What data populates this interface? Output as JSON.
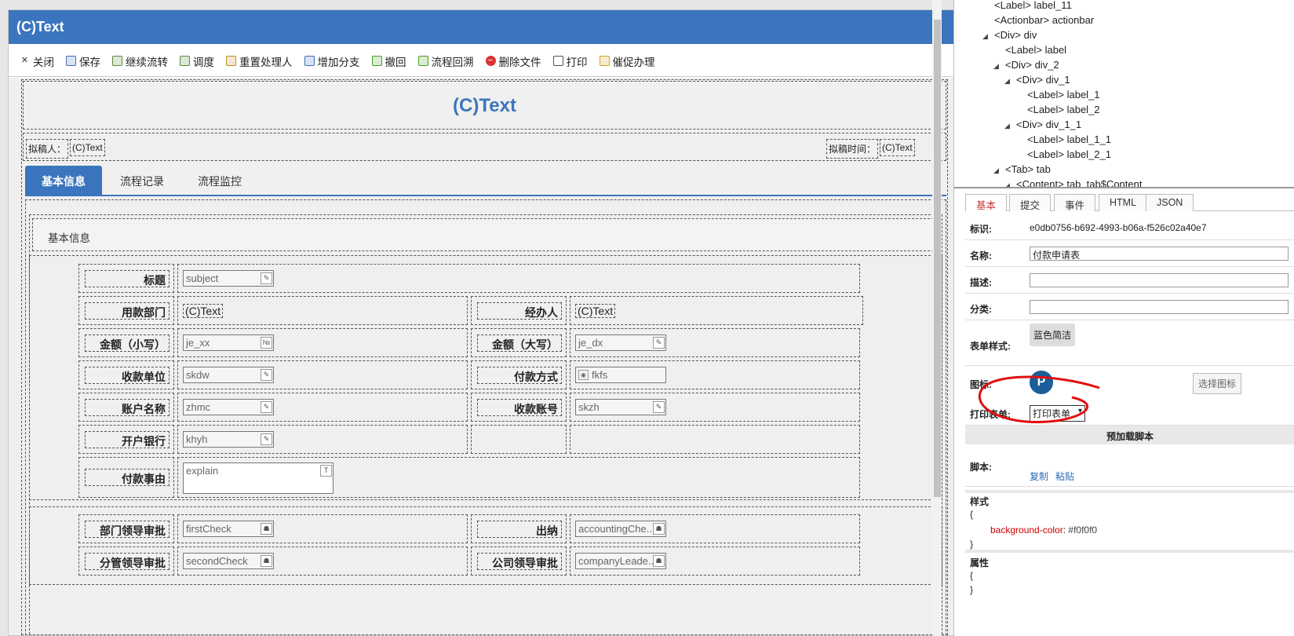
{
  "app_title": "(C)Text",
  "toolbar": [
    {
      "icon": "close-icon",
      "label": "关闭",
      "name": "close"
    },
    {
      "icon": "save-icon",
      "label": "保存",
      "name": "save"
    },
    {
      "icon": "continue-icon",
      "label": "继续流转",
      "name": "continue-flow"
    },
    {
      "icon": "adjust-icon",
      "label": "调度",
      "name": "dispatch"
    },
    {
      "icon": "reset-icon",
      "label": "重置处理人",
      "name": "reset-handler"
    },
    {
      "icon": "branch-icon",
      "label": "增加分支",
      "name": "add-branch"
    },
    {
      "icon": "undo-icon",
      "label": "撤回",
      "name": "withdraw"
    },
    {
      "icon": "trace-icon",
      "label": "流程回溯",
      "name": "flow-trace"
    },
    {
      "icon": "delete-icon",
      "label": "删除文件",
      "name": "delete-file"
    },
    {
      "icon": "print-icon",
      "label": "打印",
      "name": "print"
    },
    {
      "icon": "urge-icon",
      "label": "催促办理",
      "name": "urge"
    }
  ],
  "form": {
    "header_text": "(C)Text",
    "drafter_label": "拟稿人：",
    "drafter_value": "(C)Text",
    "draft_time_label": "拟稿时间：",
    "draft_time_value": "(C)Text",
    "tabs": [
      "基本信息",
      "流程记录",
      "流程监控"
    ],
    "section_title": "基本信息",
    "fields": {
      "subject": {
        "label": "标题",
        "value": "subject"
      },
      "dept": {
        "label": "用款部门",
        "value": "(C)Text"
      },
      "handler": {
        "label": "经办人",
        "value": "(C)Text"
      },
      "amount_small": {
        "label": "金额（小写）",
        "value": "je_xx"
      },
      "amount_big": {
        "label": "金额（大写）",
        "value": "je_dx"
      },
      "payee": {
        "label": "收款单位",
        "value": "skdw"
      },
      "pay_method": {
        "label": "付款方式",
        "value": "fkfs"
      },
      "account_name": {
        "label": "账户名称",
        "value": "zhmc"
      },
      "account_no": {
        "label": "收款账号",
        "value": "skzh"
      },
      "bank": {
        "label": "开户银行",
        "value": "khyh"
      },
      "reason": {
        "label": "付款事由",
        "value": "explain"
      },
      "dept_leader": {
        "label": "部门领导审批",
        "value": "firstCheck"
      },
      "cashier": {
        "label": "出纳",
        "value": "accountingChe..."
      },
      "vp_leader": {
        "label": "分管领导审批",
        "value": "secondCheck"
      },
      "company_leader": {
        "label": "公司领导审批",
        "value": "companyLeade..."
      }
    }
  },
  "tree": [
    {
      "indent": 0,
      "tag": "<Label> label_11",
      "toggle": false
    },
    {
      "indent": 0,
      "tag": "<Actionbar> actionbar",
      "toggle": false
    },
    {
      "indent": 0,
      "tag": "<Div> div",
      "toggle": true
    },
    {
      "indent": 1,
      "tag": "<Label> label",
      "toggle": false
    },
    {
      "indent": 1,
      "tag": "<Div> div_2",
      "toggle": true
    },
    {
      "indent": 2,
      "tag": "<Div> div_1",
      "toggle": true
    },
    {
      "indent": 3,
      "tag": "<Label> label_1",
      "toggle": false
    },
    {
      "indent": 3,
      "tag": "<Label> label_2",
      "toggle": false
    },
    {
      "indent": 2,
      "tag": "<Div> div_1_1",
      "toggle": true
    },
    {
      "indent": 3,
      "tag": "<Label> label_1_1",
      "toggle": false
    },
    {
      "indent": 3,
      "tag": "<Label> label_2_1",
      "toggle": false
    },
    {
      "indent": 1,
      "tag": "<Tab> tab",
      "toggle": true
    },
    {
      "indent": 2,
      "tag": "<Content> tab_tab$Content",
      "toggle": true
    }
  ],
  "props": {
    "tabs": [
      "基本",
      "提交",
      "事件",
      "HTML",
      "JSON"
    ],
    "id_label": "标识:",
    "id_value": "e0db0756-b692-4993-b06a-f526c02a40e7",
    "name_label": "名称:",
    "name_value": "付款申请表",
    "desc_label": "描述:",
    "category_label": "分类:",
    "style_label": "表单样式:",
    "style_value": "蓝色简洁",
    "icon_label": "图标:",
    "choose_icon": "选择图标",
    "print_label": "打印表单:",
    "print_value": "打印表单",
    "preload_title": "预加载脚本",
    "script_label": "脚本:",
    "copy": "复制",
    "paste": "粘贴",
    "css_title": "样式",
    "css_open": "{",
    "css_prop": "background-color",
    "css_val": "#f0f0f0",
    "css_close": "}",
    "attr_title": "属性",
    "attr_open": "{",
    "attr_close": "}",
    "icon_letter": "P"
  }
}
